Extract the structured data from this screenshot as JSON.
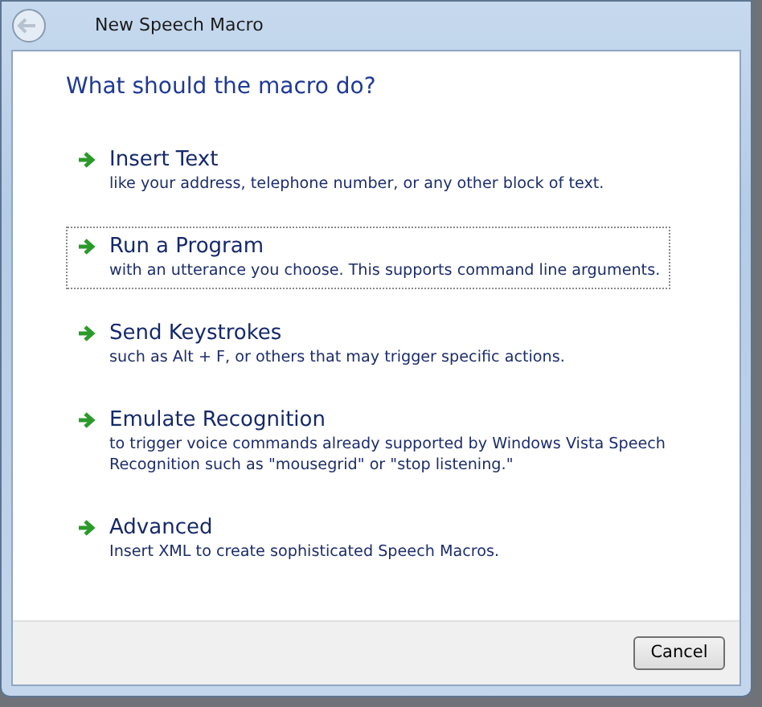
{
  "window": {
    "title": "New Speech Macro"
  },
  "heading": "What should the macro do?",
  "options": [
    {
      "title": "Insert Text",
      "description": "like your address, telephone number, or any other block of text.",
      "selected": false
    },
    {
      "title": "Run a Program",
      "description": "with an utterance you choose. This supports command line arguments.",
      "selected": true
    },
    {
      "title": "Send Keystrokes",
      "description": "such as Alt + F, or others that may trigger specific actions.",
      "selected": false
    },
    {
      "title": "Emulate Recognition",
      "description": "to trigger voice commands already supported by Windows Vista Speech Recognition such as \"mousegrid\" or \"stop listening.\"",
      "selected": false
    },
    {
      "title": "Advanced",
      "description": "Insert XML to create sophisticated Speech Macros.",
      "selected": false
    }
  ],
  "buttons": [
    "Cancel"
  ]
}
